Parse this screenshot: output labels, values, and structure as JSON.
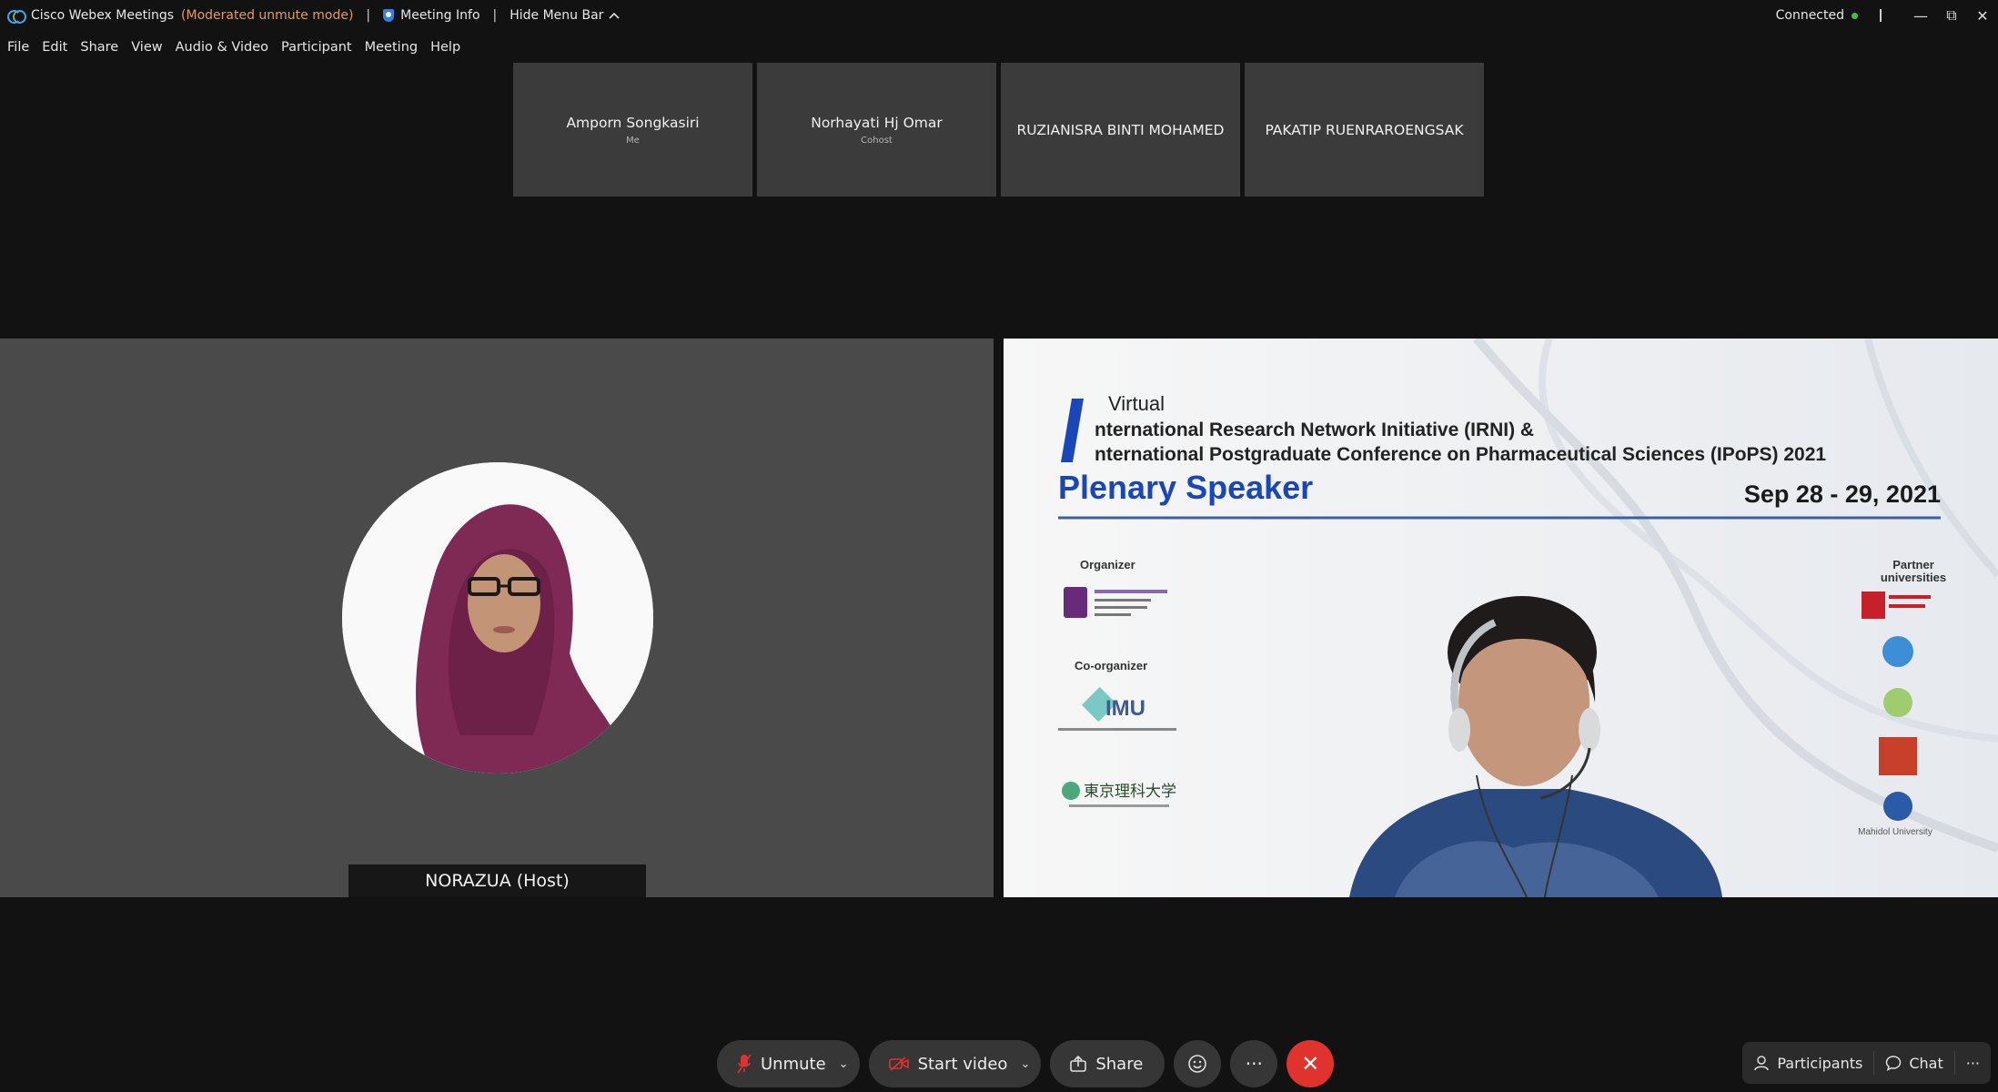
{
  "window": {
    "app_name": "Cisco Webex Meetings",
    "mode": "(Moderated unmute mode)",
    "meeting_info": "Meeting Info",
    "hide_menu_bar": "Hide Menu Bar",
    "status": "Connected"
  },
  "menu": [
    "File",
    "Edit",
    "Share",
    "View",
    "Audio & Video",
    "Participant",
    "Meeting",
    "Help"
  ],
  "participants": [
    {
      "name": "Amporn Songkasiri",
      "role": "Me"
    },
    {
      "name": "Norhayati Hj Omar",
      "role": "Cohost"
    },
    {
      "name": "RUZIANISRA BINTI MOHAMED",
      "role": ""
    },
    {
      "name": "PAKATIP RUENRAROENGSAK",
      "role": ""
    }
  ],
  "main_video": {
    "name_tag": "NORAZUA (Host)"
  },
  "slide": {
    "virtual": "Virtual",
    "line1": "nternational Research Network Initiative (IRNI) &",
    "line2": "nternational Postgraduate Conference on Pharmaceutical Sciences (IPoPS) 2021",
    "heading": "Plenary Speaker",
    "date": "Sep 28 - 29, 2021",
    "organizer": "Organizer",
    "co_organizer": "Co-organizer",
    "partner": [
      "Partner",
      "universities"
    ],
    "imu": "IMU",
    "tokyo": "東京理科大学",
    "mahidol": "Mahidol University"
  },
  "controls": {
    "unmute": "Unmute",
    "start_video": "Start video",
    "share": "Share",
    "more": "···",
    "participants": "Participants",
    "chat": "Chat",
    "side_more": "···"
  },
  "colors": {
    "accent_orange": "#e39c52",
    "end_red": "#e0332d",
    "connected_green": "#3cc33c",
    "slide_blue": "#1a47b8"
  }
}
